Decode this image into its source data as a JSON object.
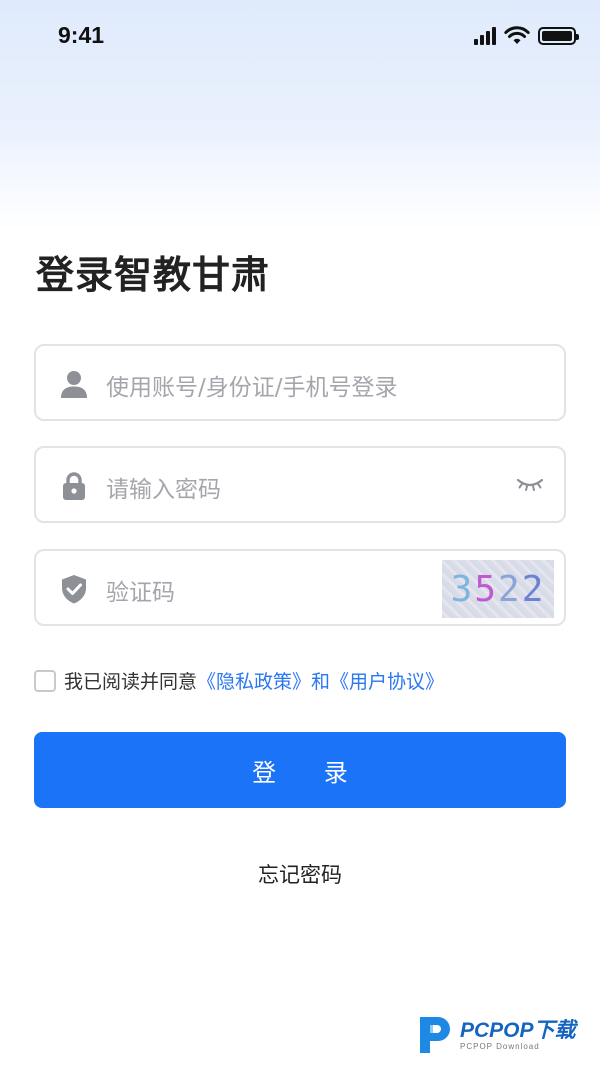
{
  "status_bar": {
    "time": "9:41"
  },
  "page": {
    "title": "登录智教甘肃"
  },
  "form": {
    "account": {
      "placeholder": "使用账号/身份证/手机号登录"
    },
    "password": {
      "placeholder": "请输入密码"
    },
    "captcha": {
      "placeholder": "验证码",
      "code": [
        "3",
        "5",
        "2",
        "2"
      ]
    }
  },
  "agreement": {
    "prefix": "我已阅读并同意",
    "privacy_link": "《隐私政策》",
    "conjunction": "和",
    "terms_link": "《用户协议》",
    "checked": false
  },
  "buttons": {
    "login": "登 录",
    "forgot": "忘记密码"
  },
  "watermark": {
    "brand": "PCPOP下载",
    "sub": "PCPOP Download"
  },
  "colors": {
    "primary": "#1b73f7",
    "link": "#2a77f2",
    "placeholder": "#a4a6ac"
  },
  "icons": [
    "user-icon",
    "lock-icon",
    "eye-closed-icon",
    "shield-check-icon",
    "wifi-icon",
    "battery-icon",
    "signal-icon"
  ]
}
